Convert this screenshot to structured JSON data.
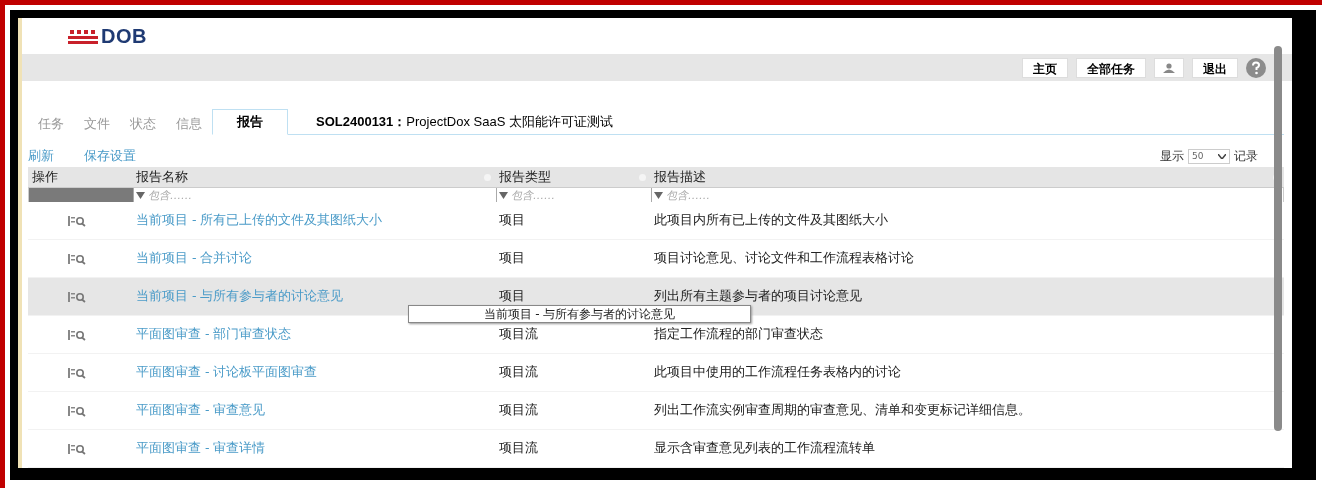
{
  "logo": {
    "text": "DOB"
  },
  "top_nav": [
    {
      "kind": "button",
      "label": "主页"
    },
    {
      "kind": "button",
      "label": "全部任务"
    },
    {
      "kind": "user"
    },
    {
      "kind": "button",
      "label": "退出"
    },
    {
      "kind": "help"
    }
  ],
  "tabs": [
    {
      "label": "任务",
      "selected": false
    },
    {
      "label": "文件",
      "selected": false
    },
    {
      "label": "状态",
      "selected": false
    },
    {
      "label": "信息",
      "selected": false
    },
    {
      "label": "报告",
      "selected": true
    }
  ],
  "project_title": {
    "code": "SOL2400131：",
    "name": "ProjectDox SaaS 太阳能许可证测试"
  },
  "actions": [
    "刷新",
    "保存设置"
  ],
  "page_size": {
    "prefix": "显示",
    "value": "50",
    "suffix": "记录"
  },
  "table": {
    "columns": [
      {
        "label": "操作",
        "filter": false
      },
      {
        "label": "报告名称",
        "filter": true,
        "placeholder": "包含……"
      },
      {
        "label": "报告类型",
        "filter": true,
        "placeholder": "包含……"
      },
      {
        "label": "报告描述",
        "filter": true,
        "placeholder": "包含……"
      }
    ],
    "rows": [
      {
        "name": "当前项目 - 所有已上传的文件及其图纸大小",
        "type": "项目",
        "description": "此项目内所有已上传的文件及其图纸大小",
        "selected": false
      },
      {
        "name": "当前项目 - 合并讨论",
        "type": "项目",
        "description": "项目讨论意见、讨论文件和工作流程表格讨论",
        "selected": false
      },
      {
        "name": "当前项目 - 与所有参与者的讨论意见",
        "type": "项目",
        "description": "列出所有主题参与者的项目讨论意见",
        "selected": true
      },
      {
        "name": "平面图审查 - 部门审查状态",
        "type": "项目流",
        "description": "指定工作流程的部门审查状态",
        "selected": false
      },
      {
        "name": "平面图审查 - 讨论板平面图审查",
        "type": "项目流",
        "description": "此项目中使用的工作流程任务表格内的讨论",
        "selected": false
      },
      {
        "name": "平面图审查 - 审查意见",
        "type": "项目流",
        "description": "列出工作流实例审查周期的审查意见、清单和变更标记详细信息。",
        "selected": false
      },
      {
        "name": "平面图审查 - 审查详情",
        "type": "项目流",
        "description": "显示含审查意见列表的工作流程流转单",
        "selected": false
      }
    ]
  },
  "tooltip": {
    "text": "当前项目 - 与所有参与者的讨论意见"
  }
}
